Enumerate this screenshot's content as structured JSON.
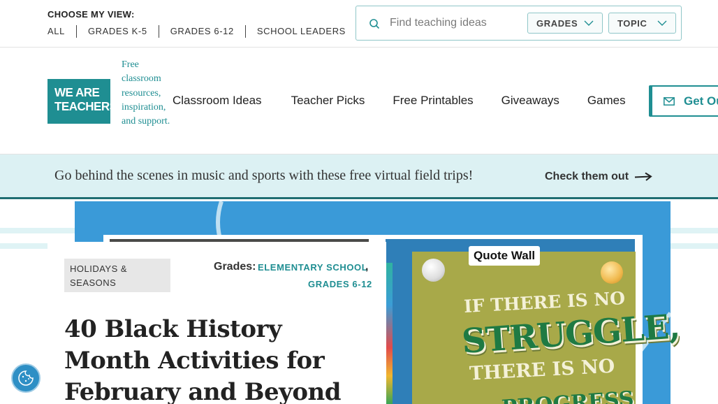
{
  "topbar": {
    "view_label": "CHOOSE MY VIEW:",
    "view_links": [
      "ALL",
      "GRADES K-5",
      "GRADES 6-12",
      "SCHOOL LEADERS"
    ],
    "search_placeholder": "Find teaching ideas",
    "grades_select": "GRADES",
    "topic_select": "TOPIC"
  },
  "header": {
    "logo_line1": "WE ARE",
    "logo_line2": "TEACHERS",
    "tagline": "Free classroom resources, inspiration, and support.",
    "nav": [
      "Classroom Ideas",
      "Teacher Picks",
      "Free Printables",
      "Giveaways",
      "Games"
    ],
    "cta_label": "Get Our"
  },
  "promo": {
    "text": "Go behind the scenes in music and sports with these free virtual field trips!",
    "cta": "Check them out"
  },
  "hero": {
    "quote_label": "Quote Wall",
    "poster_line1": "IF THERE IS NO",
    "poster_line2": "STRUGGLE,",
    "poster_line3": "THERE IS NO",
    "poster_line4": "PROGRESS"
  },
  "article": {
    "category": "HOLIDAYS & SEASONS",
    "grades_label": "Grades:",
    "grade_links": [
      "ELEMENTARY SCHOOL",
      "GRADES 6-12"
    ],
    "title": "40 Black History Month Activities for February and Beyond"
  },
  "colors": {
    "brand_teal": "#1f8e92",
    "promo_bg": "#dcf1f3",
    "hero_blue": "#3a9ad8"
  }
}
